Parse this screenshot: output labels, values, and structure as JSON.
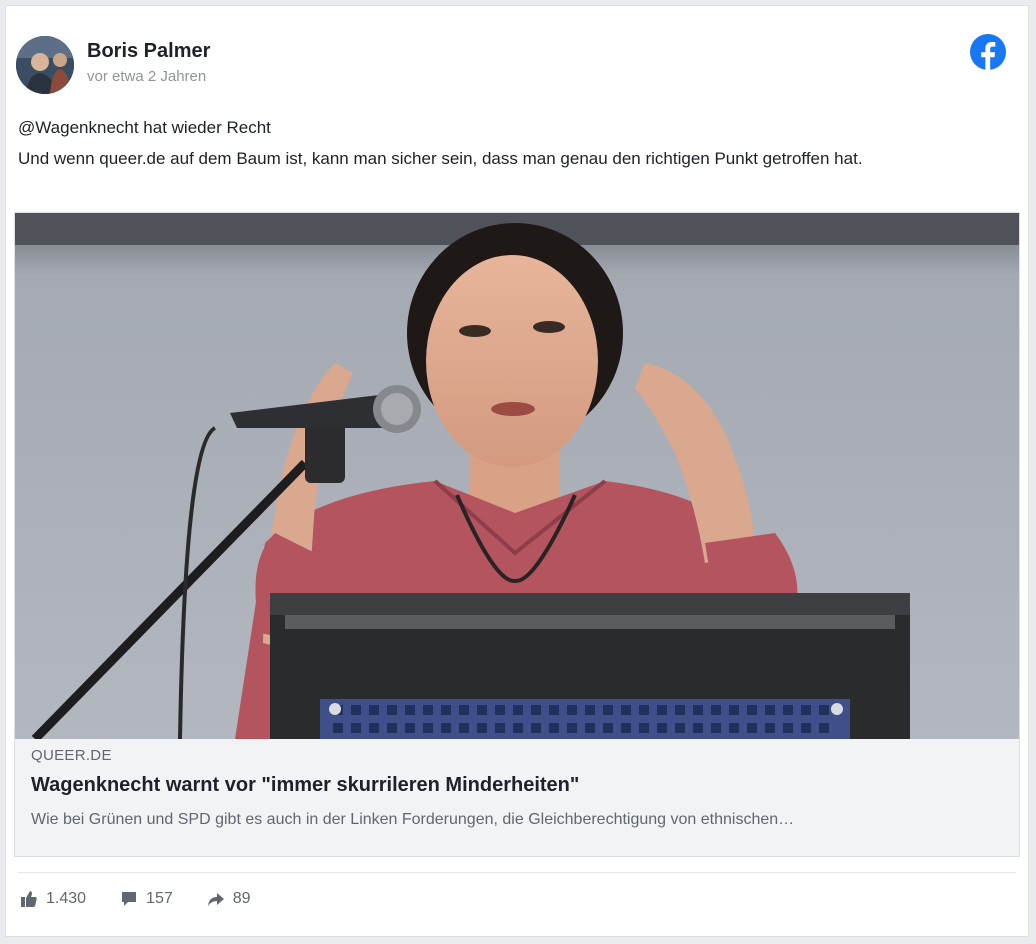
{
  "post": {
    "author": "Boris Palmer",
    "timestamp": "vor etwa 2 Jahren",
    "text_line1": "@Wagenknecht hat wieder Recht",
    "text_line2": "Und wenn queer.de auf dem Baum ist, kann man sicher sein, dass man genau den richtigen Punkt getroffen hat.",
    "brand_icon": "facebook-icon",
    "brand_color": "#1877f2"
  },
  "link": {
    "domain": "QUEER.DE",
    "headline": "Wagenknecht warnt vor \"immer skurrileren Minderheiten\"",
    "description": "Wie bei Grünen und SPD gibt es auch in der Linken Forderungen, die Gleichberechtigung von ethnischen…"
  },
  "stats": {
    "likes": "1.430",
    "comments": "157",
    "shares": "89",
    "like_icon": "thumbs-up-icon",
    "comment_icon": "comment-icon",
    "share_icon": "share-icon"
  }
}
